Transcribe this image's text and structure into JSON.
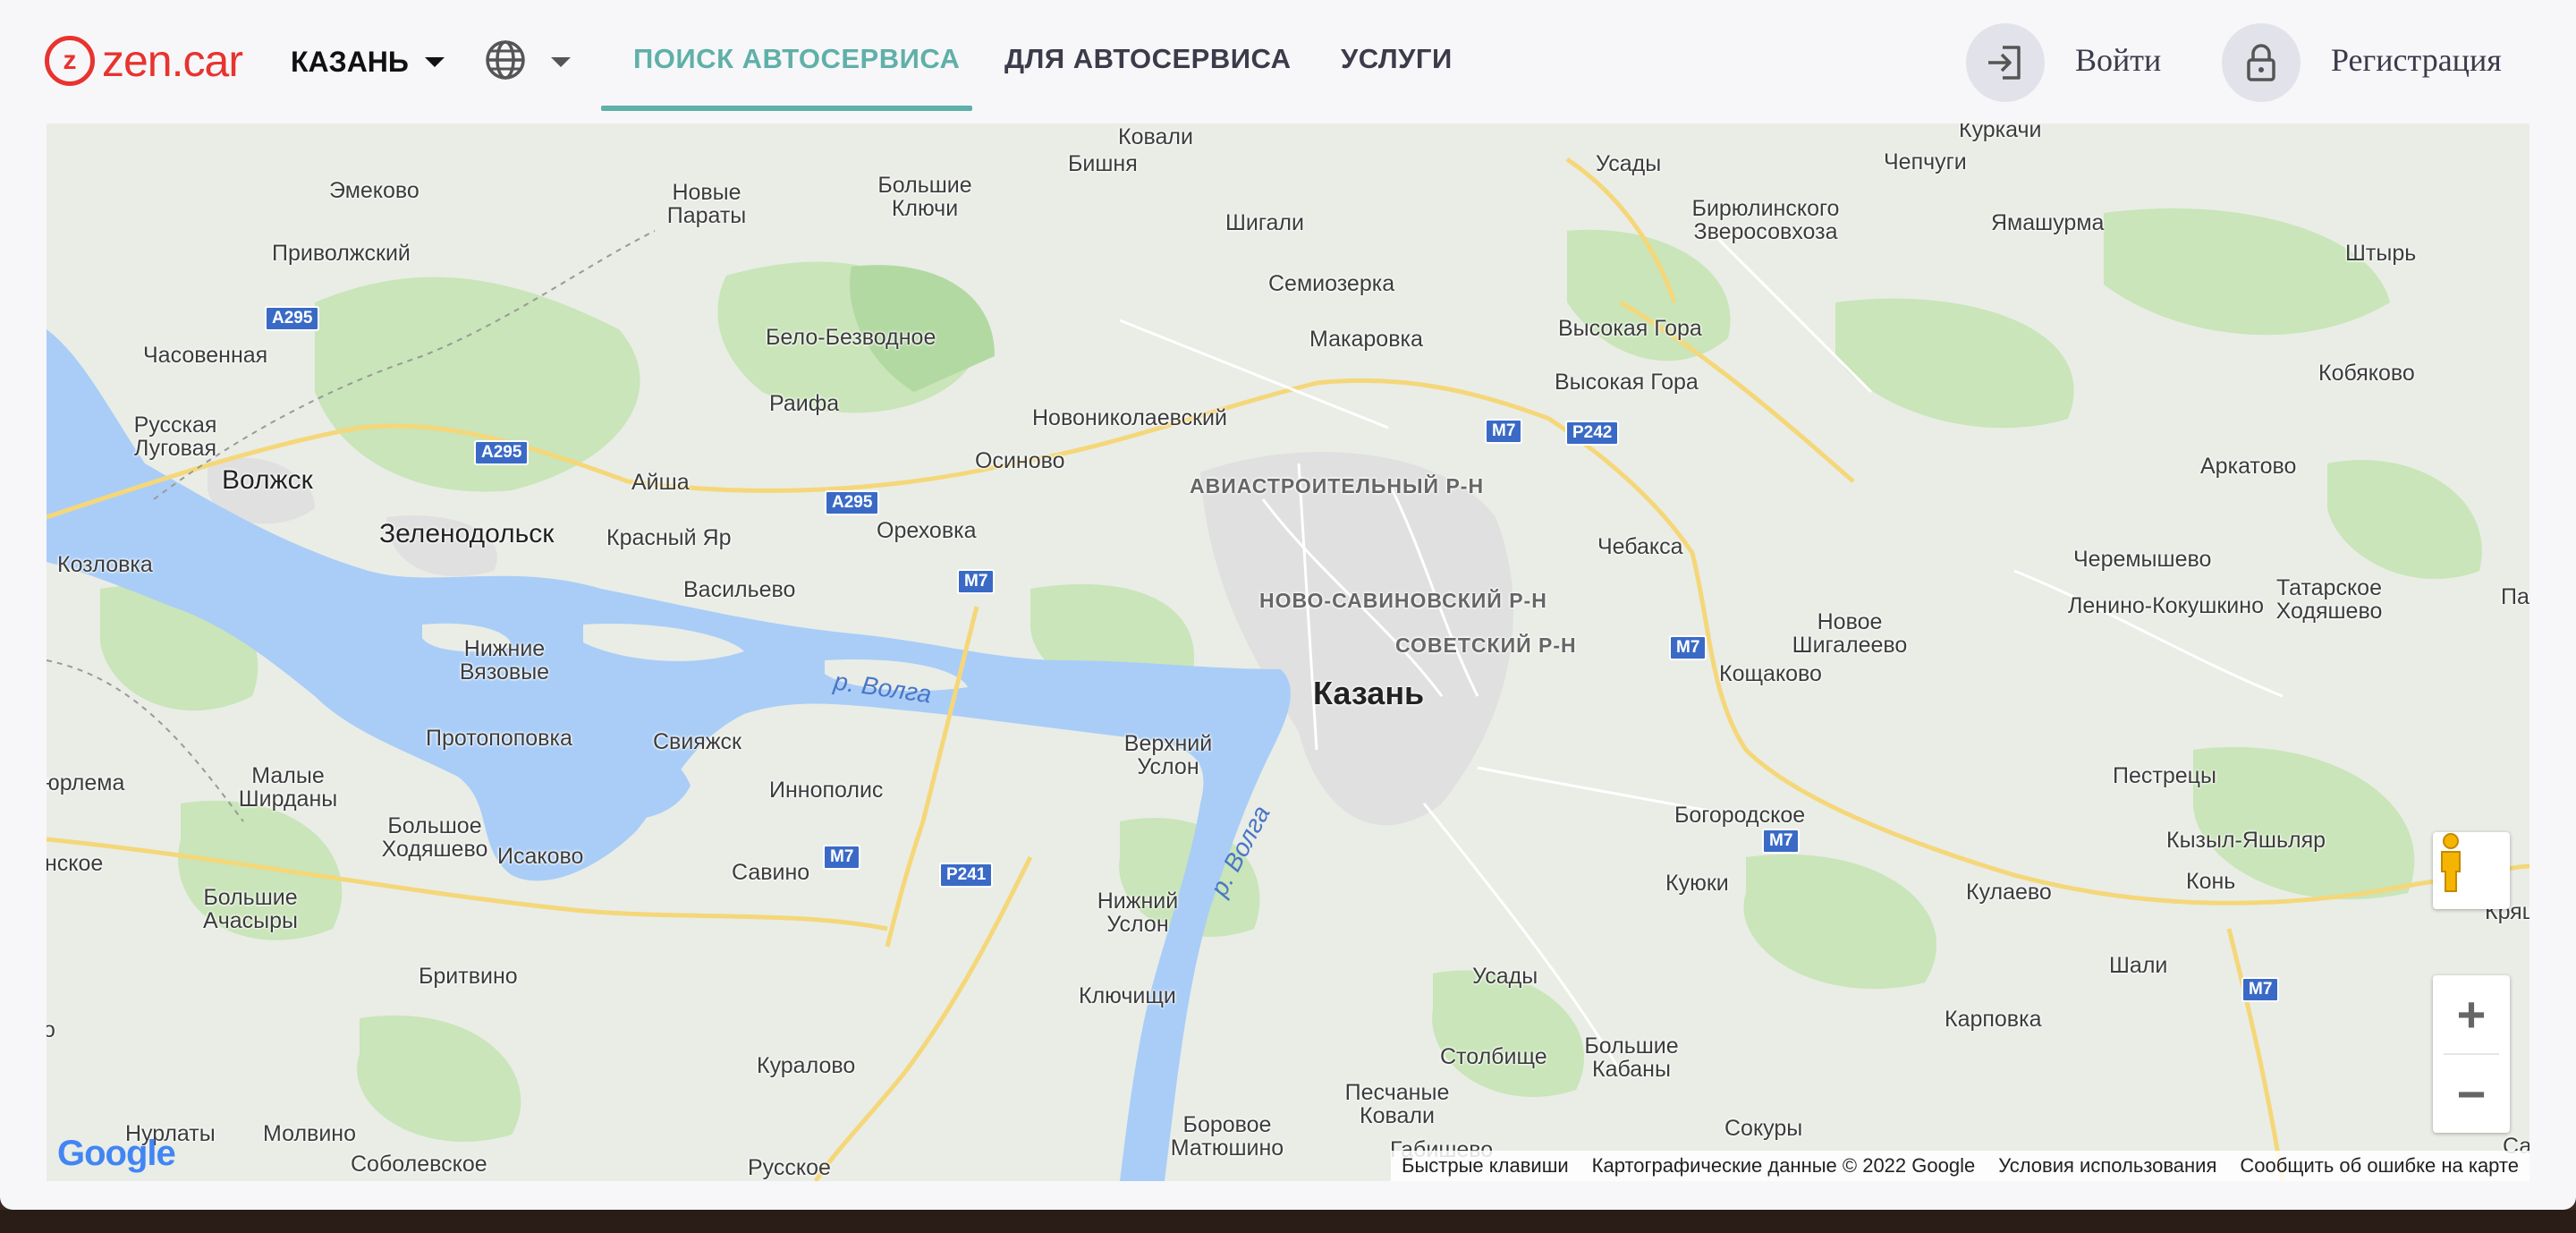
{
  "header": {
    "logo_symbol": "z",
    "logo_text": "zen.car",
    "city": "КАЗАНЬ",
    "nav": [
      {
        "label": "ПОИСК АВТОСЕРВИСА",
        "active": true
      },
      {
        "label": "ДЛЯ АВТОСЕРВИСА",
        "active": false
      },
      {
        "label": "УСЛУГИ",
        "active": false
      }
    ],
    "login_label": "Войти",
    "register_label": "Регистрация"
  },
  "map": {
    "labels": {
      "kovali_top": "Ковали",
      "bishnya": "Бишня",
      "bolshie_klyuchi": "Большие\nКлючи",
      "emekovo": "Эмеково",
      "novye_paraty": "Новые\nПараты",
      "privolzhsky": "Приволжский",
      "usady_top": "Усады",
      "kurkachi": "Куркачи",
      "chepchugi": "Чепчуги",
      "biryulinskogo": "Бирюлинского\nЗверосовхоза",
      "yamashurma": "Ямашурма",
      "shtyr": "Штырь",
      "shigali": "Шигали",
      "semiozerka": "Семиозерка",
      "chasovennaya": "Часовенная",
      "belo_bezvodnoe": "Бело-Безводное",
      "makarovka": "Макаровка",
      "vysokaya_gora_1": "Высокая Гора",
      "vysokaya_gora_2": "Высокая Гора",
      "kobyakovo": "Кобяково",
      "russkaya_lugovaya": "Русская\nЛуговая",
      "raifa": "Раифа",
      "novonikolaevsky": "Новониколаевский",
      "volzhsk": "Волжск",
      "aysha": "Айша",
      "osinovo": "Осиново",
      "aviastroitelny": "АВИАСТРОИТЕЛЬНЫЙ Р-Н",
      "arkatovo": "Аркатово",
      "zelenodolsk": "Зеленодольск",
      "krasny_yar": "Красный Яр",
      "orekhovka": "Ореховка",
      "chebaksa": "Чебакса",
      "kozlovka": "Козловка",
      "vasilyevo": "Васильево",
      "novo_savinovsky": "НОВО-САВИНОВСКИЙ Р-Н",
      "cheremyshevo": "Черемышево",
      "lenino_kokushkino": "Ленино-Кокушкино",
      "tatarskoe_khodyashevo": "Татарское\nХодяшево",
      "pa": "Па",
      "nizhnie_vyazovye": "Нижние\nВязовые",
      "sovetsky": "СОВЕТСКИЙ Р-Н",
      "novoe_shigaleevo": "Новое\nШигалеево",
      "koshchakovo": "Кощаково",
      "volga_1": "р. Волга",
      "kazan": "Казань",
      "protopopovka": "Протопоповка",
      "sviyazhsk": "Свияжск",
      "verkhny_uslon": "Верхний\nУслон",
      "yurlema": "юрлема",
      "malye_shirdany": "Малые\nШирданы",
      "innopolis": "Иннополис",
      "pestretsy": "Пестрецы",
      "bolshoe_khodyashevo": "Большое\nХодяшево",
      "isakovo": "Исаково",
      "bogorodskoe": "Богородское",
      "volga_2": "р. Волга",
      "kyzyl_yashlyar": "Кызыл-Яшьляр",
      "nskoe": "нское",
      "savino": "Савино",
      "kuyuki": "Куюки",
      "kulaevo": "Кулаево",
      "kon": "Конь",
      "bolshie_achasyry": "Большие\nАчасыры",
      "nizhny_uslon": "Нижний\nУслон",
      "kryash": "Кряш-",
      "shali": "Шали",
      "britvino": "Бритвино",
      "usady_bottom": "Усады",
      "klyuchishchi": "Ключищи",
      "karpovka": "Карповка",
      "o_left": "о",
      "stolbishche": "Столбище",
      "bolshie_kabany": "Большие\nКабаны",
      "kuralovo": "Куралово",
      "peschanye_kovali": "Песчаные\nКовали",
      "nurlaty": "Нурлаты",
      "molvino": "Молвино",
      "borovoe_matyushino": "Боровое\nМатюшино",
      "sokury": "Сокуры",
      "sale": "Сал",
      "sobolevskoe": "Соболевское",
      "russkoe": "Русское",
      "gabishevo": "Габишево"
    },
    "shields": {
      "a295_1": "A295",
      "a295_2": "A295",
      "a295_3": "A295",
      "m7_1": "M7",
      "m7_2": "M7",
      "m7_3": "M7",
      "m7_4": "M7",
      "m7_5": "M7",
      "m7_6": "M7",
      "p242": "P242",
      "p241": "P241"
    },
    "google_logo": "Google",
    "footer": {
      "shortcuts": "Быстрые клавиши",
      "data": "Картографические данные © 2022 Google",
      "terms": "Условия использования",
      "report": "Сообщить об ошибке на карте"
    },
    "zoom_in": "+",
    "zoom_out": "−",
    "colors": {
      "water": "#a9cdf7",
      "forest": "#c5e3b5",
      "road": "#f5d77a",
      "urban": "#e3e3e3"
    }
  }
}
